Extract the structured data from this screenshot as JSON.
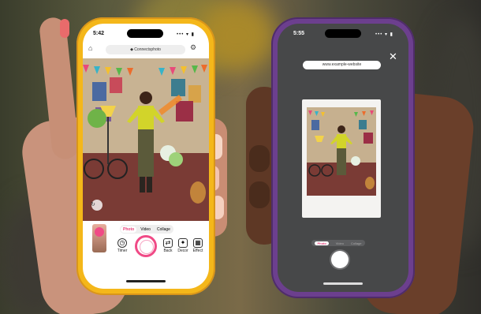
{
  "left_phone": {
    "status_time": "5:42",
    "status_icons": "••• ▾ ▮",
    "url": "◆ Connectsphoto",
    "camera_modes": [
      "Photo",
      "Video",
      "Collage"
    ],
    "active_mode": "Photo",
    "tools": [
      {
        "label": "Timer",
        "icon": "timer-icon",
        "glyph": "◷"
      },
      {
        "label": "Back",
        "icon": "flip-camera-icon",
        "glyph": "⇄"
      },
      {
        "label": "Decor",
        "icon": "decor-icon",
        "glyph": "✦"
      },
      {
        "label": "Effect",
        "icon": "effect-icon",
        "glyph": "▦"
      }
    ],
    "home_icon": "house-icon",
    "settings_icon": "gear-icon",
    "flip_icon": "rotate-icon"
  },
  "right_phone": {
    "status_time": "5:55",
    "status_icons": "••• ▾ ▮",
    "caption": "www.example-website",
    "close_icon": "close-icon",
    "camera_modes": [
      "Photo",
      "Video",
      "Collage"
    ],
    "active_mode": "Photo"
  },
  "colors": {
    "yellow_case": "#f4b71a",
    "purple_case": "#6c3f8e",
    "accent_pink": "#f04a86",
    "dark_screen": "#474849"
  }
}
